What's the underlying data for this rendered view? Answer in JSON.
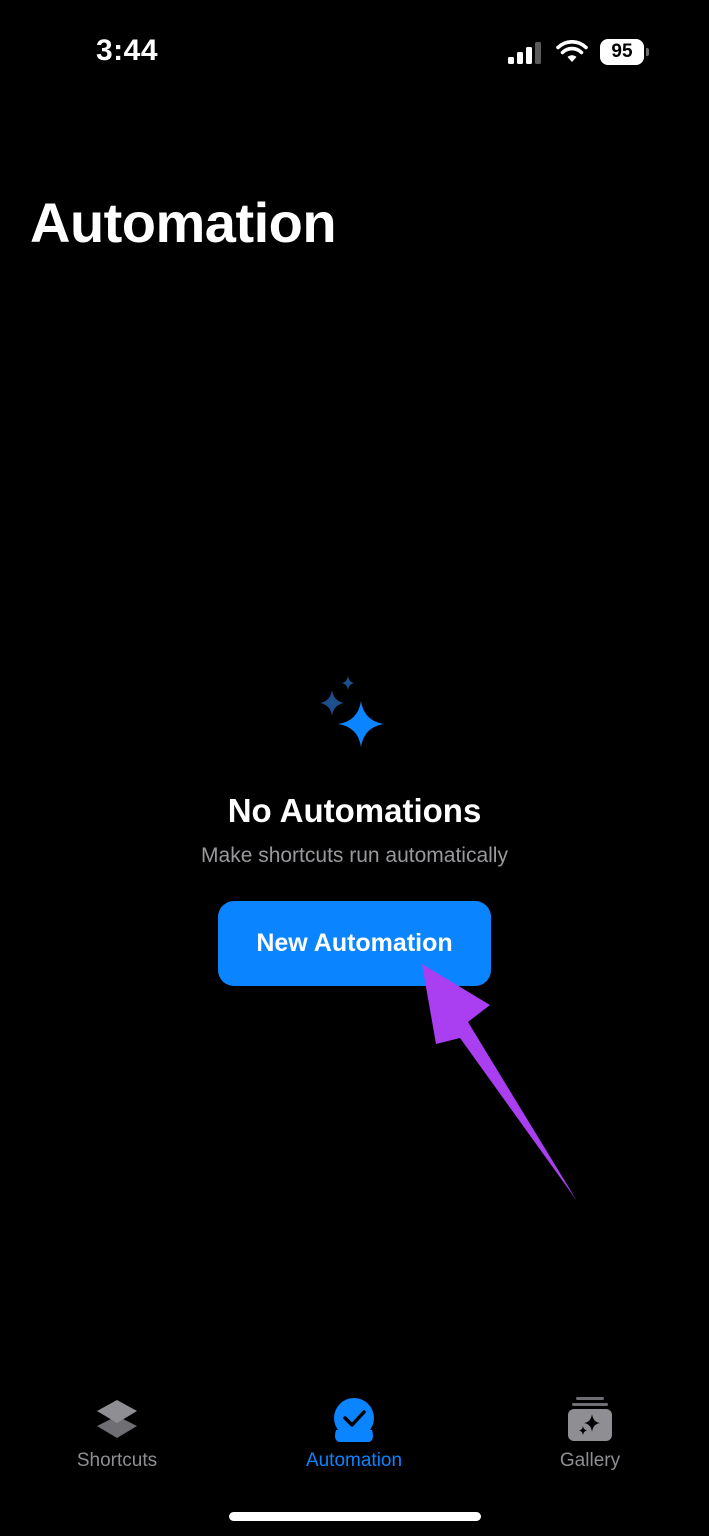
{
  "status_bar": {
    "time": "3:44",
    "battery_level": "95",
    "icons": [
      "signal-icon",
      "wifi-icon",
      "battery-icon"
    ]
  },
  "header": {
    "title": "Automation"
  },
  "empty_state": {
    "icon": "sparkle-icon",
    "title": "No Automations",
    "subtitle": "Make shortcuts run automatically",
    "button_label": "New Automation"
  },
  "tab_bar": {
    "tabs": [
      {
        "label": "Shortcuts",
        "icon": "layers-icon",
        "selected": false
      },
      {
        "label": "Automation",
        "icon": "clock-check-icon",
        "selected": true
      },
      {
        "label": "Gallery",
        "icon": "gallery-sparkle-icon",
        "selected": false
      }
    ]
  },
  "colors": {
    "background": "#000000",
    "accent": "#0a84ff",
    "inactive_tab": "#8e8e93",
    "subtitle": "#98989d",
    "annotation_arrow": "#a93ff0"
  }
}
